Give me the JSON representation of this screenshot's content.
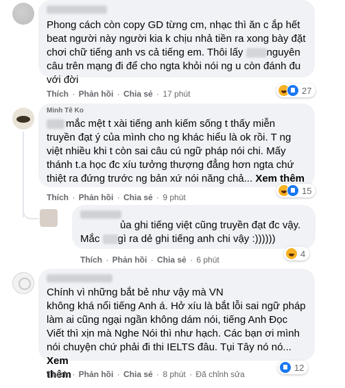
{
  "comments": [
    {
      "lines": [
        "Phong cách còn copy GD từng cm, nhạc thì ăn c ắp hết",
        "beat người này người kia k chịu nhả tiền ra xong bày đặt",
        "chơi chữ tiếng anh vs cả tiếng em. Thôi lấy",
        "nguyên",
        "câu trên mạng đi để cho ngta khỏi nói ng u còn đánh đu",
        "với đời"
      ],
      "actions": {
        "like": "Thích",
        "reply": "Phản hồi",
        "share": "Chia sẻ",
        "time": "17 phút"
      },
      "reaction_count": "27"
    },
    {
      "author_visible": "Minh Tê Ko",
      "lines": [
        "mắc mệt t xài tiếng anh kiếm sống t thấy miễn",
        "truyền đạt ý của mình cho ng khác hiểu là ok rồi. T ng",
        "việt nhiều khi t còn sai câu cú ngữ pháp nói chi. Mấy",
        "thánh t.a học đc xíu tưởng thượng đẳng hơn ngta chứ",
        "thiệt ra đứng trước ng bản xứ nói năng chả..."
      ],
      "more": "Xem thêm",
      "actions": {
        "like": "Thích",
        "reply": "Phản hồi",
        "share": "Chia sẻ",
        "time": "9 phút"
      },
      "reaction_count": "15"
    },
    {
      "lines": [
        "ủa ghi tiếng việt cũng truyền đạt đc vậy.",
        "Mắc",
        "gì ra dẻ ghi tiếng anh chi vậy :))))))"
      ],
      "actions": {
        "like": "Thích",
        "reply": "Phản hồi",
        "share": "Chia sẻ",
        "time": "6 phút"
      },
      "reaction_count": "4"
    },
    {
      "lines": [
        "Chính vì những bắt bẻ như vậy mà VN",
        "không khá nổi tiếng Anh á. Hở xíu là bắt lỗi sai ngữ pháp",
        "làm ai cũng ngại ngần không dám nói, tiếng Anh Đọc",
        "Viết thì xịn mà Nghe Nói thì như hạch. Các bạn ơi mình",
        "nói chuyện chứ phải đi thi IELTS đâu. Tụi Tây nó nó..."
      ],
      "more_a": "Xem",
      "more_b": "thêm",
      "actions": {
        "like": "Thích",
        "reply": "Phản hồi",
        "share": "Chia sẻ",
        "time": "8 phút",
        "edited": "Đã chỉnh sửa"
      },
      "reaction_count": "12"
    }
  ],
  "separator": "·"
}
